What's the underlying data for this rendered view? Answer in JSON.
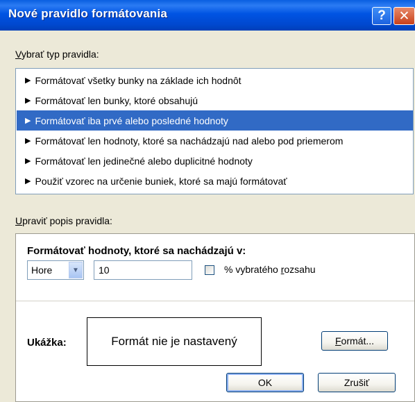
{
  "window": {
    "title": "Nové pravidlo formátovania",
    "help_glyph": "?",
    "close_glyph": "✕"
  },
  "rule_type": {
    "label_first": "V",
    "label_rest": "ybrať typ pravidla:",
    "items": [
      {
        "label": "Formátovať všetky bunky na základe ich hodnôt",
        "selected": false
      },
      {
        "label": "Formátovať len bunky, ktoré obsahujú",
        "selected": false
      },
      {
        "label": "Formátovať iba prvé alebo posledné hodnoty",
        "selected": true
      },
      {
        "label": "Formátovať len hodnoty, ktoré sa nachádzajú nad alebo pod priemerom",
        "selected": false
      },
      {
        "label": "Formátovať len jedinečné alebo duplicitné hodnoty",
        "selected": false
      },
      {
        "label": "Použiť vzorec na určenie buniek, ktoré sa majú formátovať",
        "selected": false
      }
    ],
    "arrow_glyph": "▶"
  },
  "edit_desc": {
    "label_first": "U",
    "label_rest": "praviť popis pravidla:",
    "heading": "Formátovať hodnoty, ktoré sa nachádzajú v:",
    "position_select": "Hore",
    "rank_value": "10",
    "percent_label_a": "% vybratého ",
    "percent_label_u": "r",
    "percent_label_b": "ozsahu",
    "percent_checked": false,
    "preview_label": "Ukážka:",
    "preview_text": "Formát nie je nastavený",
    "format_button_a": "",
    "format_button_u": "F",
    "format_button_b": "ormát..."
  },
  "buttons": {
    "ok": "OK",
    "cancel": "Zrušiť"
  },
  "colors": {
    "selection": "#316ac5",
    "titlebar": "#0054e3",
    "dialog_bg": "#ece9d8"
  }
}
